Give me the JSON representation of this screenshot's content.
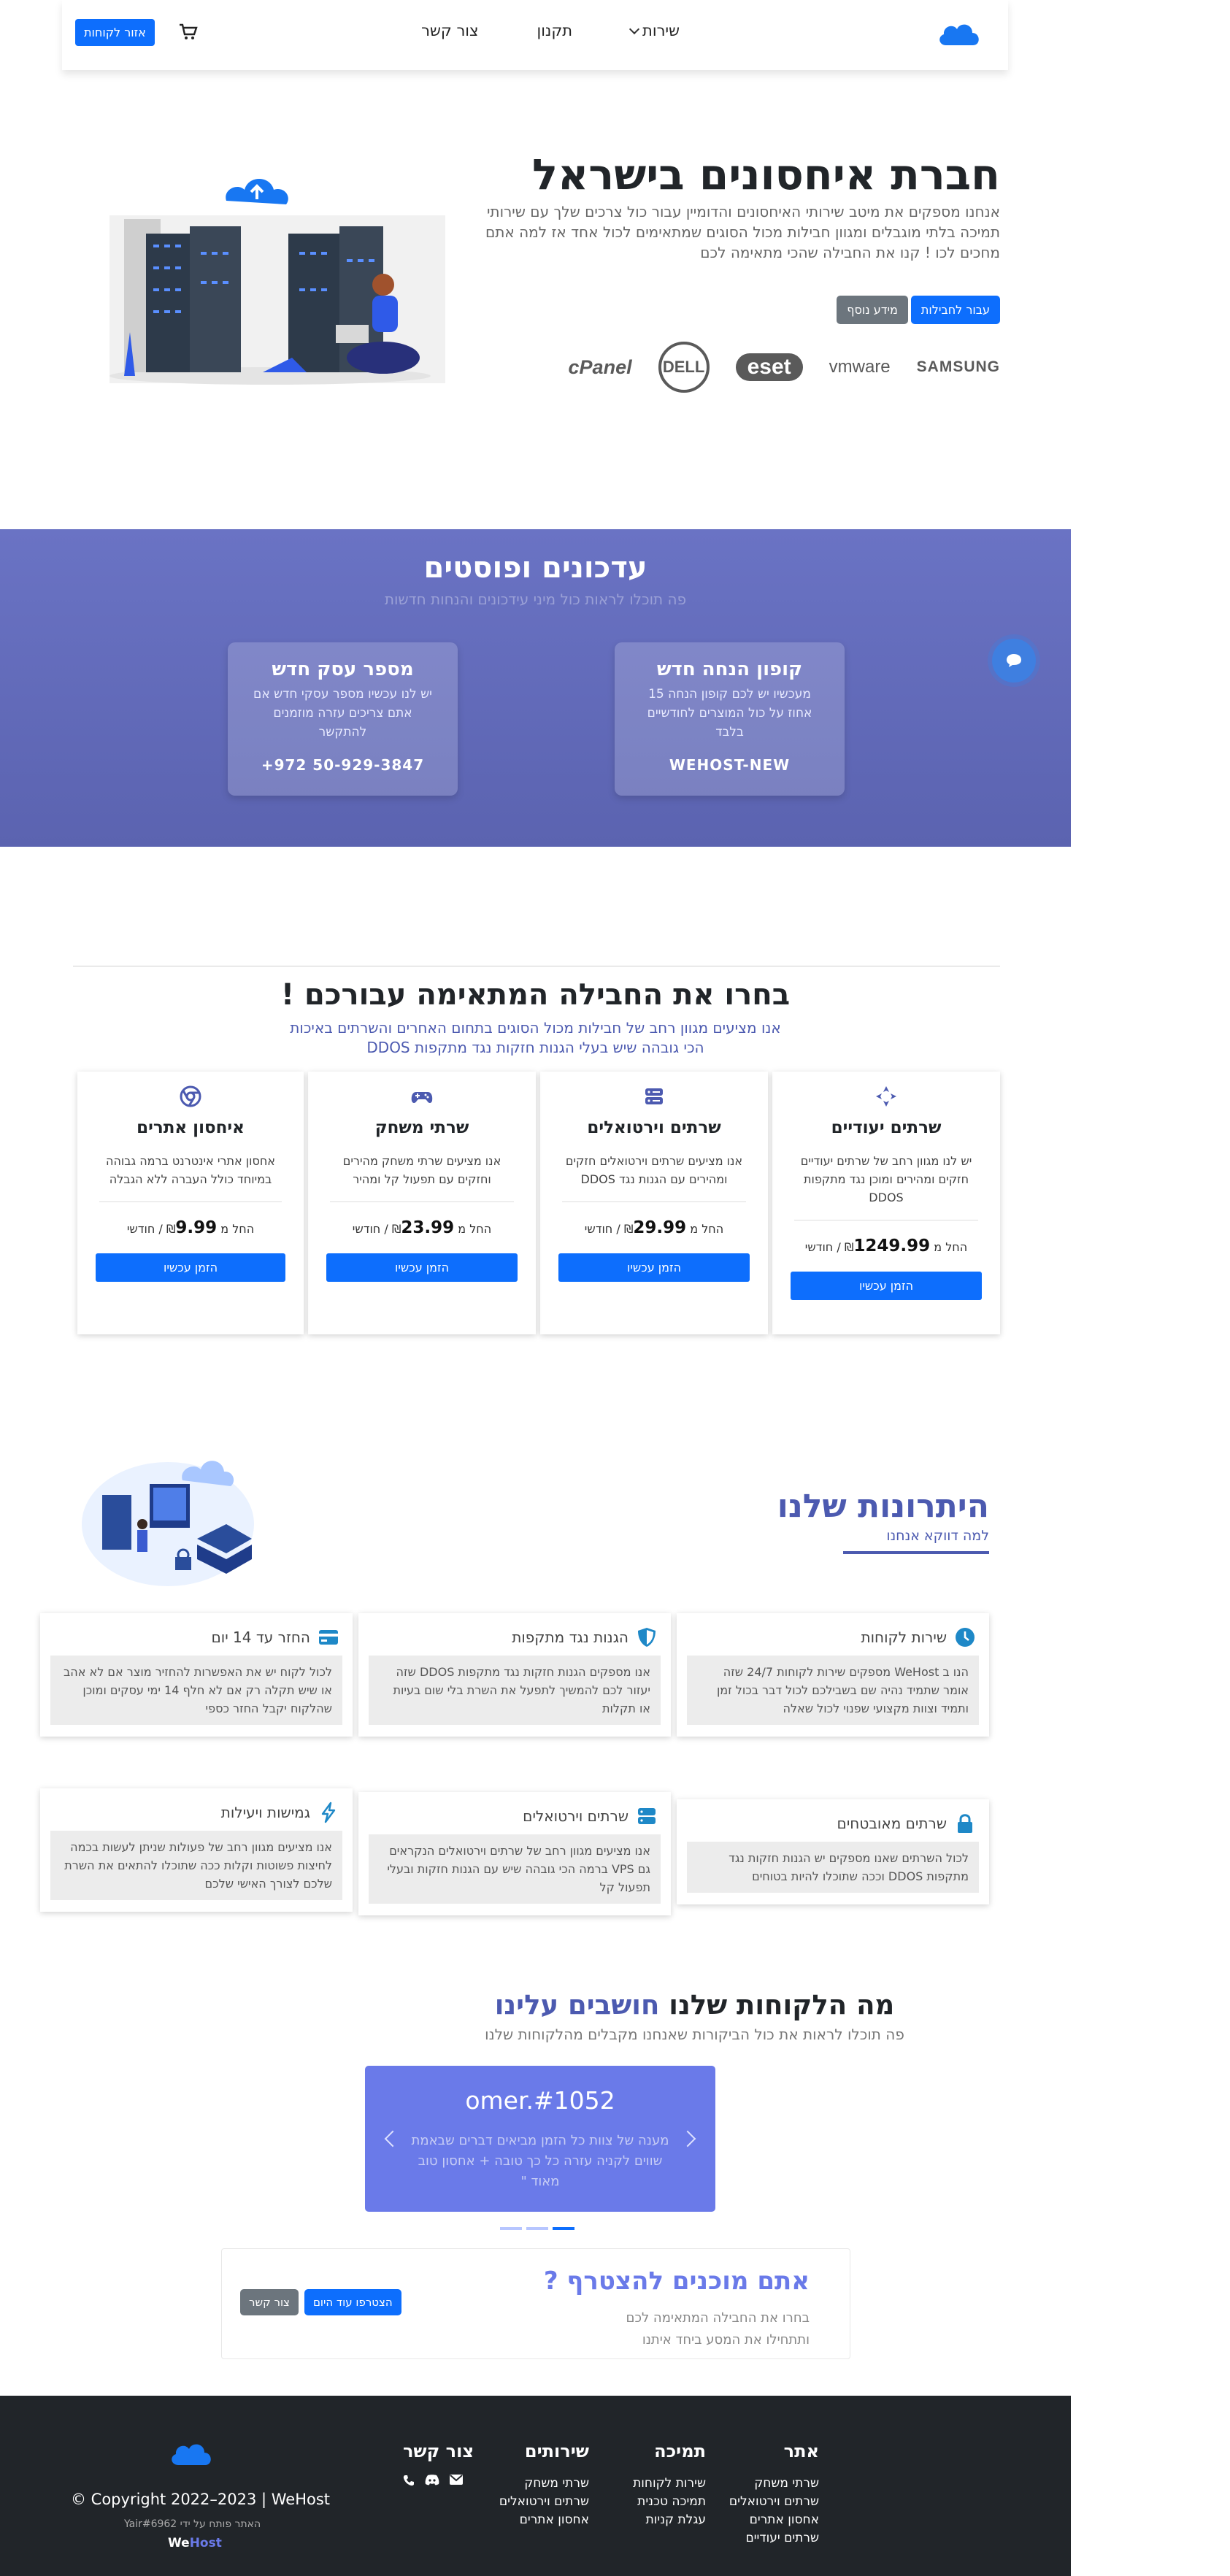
{
  "colors": {
    "primary": "#0d6efd",
    "accent": "#4c5ab0",
    "updates_bg": "#5b63b0",
    "footer_bg": "#212529"
  },
  "navbar": {
    "brand_icon": "cloud-logo-icon",
    "links": [
      "שירות",
      "תקנון",
      "צור קשר"
    ],
    "customers_button": "אזור לקוחות",
    "cart_icon": "cart-icon"
  },
  "hero": {
    "title": "חברת איחסונים בישראל",
    "description": "אנחנו מספקים את מיטב שירותי האיחסונים והדומיין עבור כול צרכים שלך עם שירותי תמיכה בלתי מוגבלים ומגוון חבילות מכול הסוגים שמתאימים לכול אחד אז למה אתם מחכים לכו ! קנו את החבילה שהכי מתאימה לכם",
    "button_packages": "עבור לחבילות",
    "button_more": "מידע נוסף",
    "brands": [
      "SAMSUNG",
      "vmware",
      "eset",
      "DELL",
      "cPanel"
    ]
  },
  "updates": {
    "title": "עדכונים ופוסטים",
    "subtitle": "פה תוכלו לראות כול מיני עידכונים והנחות חדשות",
    "cards": [
      {
        "title": "קופון הנחה חדש",
        "desc": "מעכשיו יש לכם קופון הנחה 15 אחוז על כול המוצרים לחודשיים בלבד",
        "value": "WEHOST-NEW"
      },
      {
        "title": "מספר עסק חדש",
        "desc": "יש לנו עכשיו מספר עסקי חדש אם אתם צריכים עזרה מוזמנים להתקשר",
        "value": "+972 50-929-3847"
      }
    ],
    "chat_icon": "chat-bubble-icon"
  },
  "packages": {
    "title": "בחרו את החבילה המתאימה עבורכם !",
    "subtitle_line1": "אנו מציעים מגוון רחב של חבילות מכול הסוגים בתחום האחרים והשרתים באיכות",
    "subtitle_line2": "הכי גובהה שיש בעלי הגנות חזקות נגד מתקפות DDOS",
    "price_prefix": "החל מ",
    "currency": "₪",
    "per_month": "/ חודשי",
    "order_label": "הזמן עכשיו",
    "items": [
      {
        "icon": "dedicated-server-icon",
        "name": "שרתים יעודיים",
        "desc": "יש לנו מגוון רחב של שרתים יעודיים חזקים ומהירים ומוכן נגד מתקפות DDOS",
        "price": "1249.99"
      },
      {
        "icon": "vps-server-icon",
        "name": "שרתים וירטואלים",
        "desc": "אנו מציעים שרתים וירטואלים חזקים ומהירים עם הגנות נגד DDOS",
        "price": "29.99"
      },
      {
        "icon": "gamepad-icon",
        "name": "שרתי משחק",
        "desc": "אנו מציעים שרתי משחק מהירים וחזקים עם תפעול קל ומהיר",
        "price": "23.99"
      },
      {
        "icon": "chrome-icon",
        "name": "איחסון אתרים",
        "desc": "אחסון אתרי אינטרנט ברמה גבוהה במיוחד כולל העברה ללא הגבלה",
        "price": "9.99"
      }
    ]
  },
  "advantages": {
    "title": "היתרונות שלנו",
    "subtitle": "למה דווקא אנחנו",
    "items": [
      {
        "icon": "clock-icon",
        "title": "שירות לקוחות",
        "desc": "הנו ב WeHost מספקים שירות לקוחות 24/7 שזה אומר שתמיד נהיה שם בשבילכם לכול דבר בכול זמן ותמיד וצוות מקצועי שפנוי לכול שאלה"
      },
      {
        "icon": "shield-icon",
        "title": "הגנות נגד מתקפות",
        "desc": "אנו מספקים הגנות חזקות נגד מתקפות DDOS שזה יעזור לכם להמשיך לתפעל את השרת בלי שום בעיות או תקלות"
      },
      {
        "icon": "credit-card-icon",
        "title": "החזר עד 14 יום",
        "desc": "לכול לקוח יש את האפשרות להחזיר מוצר אם לא אהב או שיש תקלה רק אם לא חלף 14 ימי עסקים ומוכן שהלקוח יקבל החזר כספי"
      },
      {
        "icon": "lock-icon",
        "title": "שרתים מאובטחים",
        "desc": "לכול השרתים שאנו מספקים יש הגנות חזקות נגד מתקפות DDOS וככה שתוכלו להיות בטוחים"
      },
      {
        "icon": "server-icon",
        "title": "שרתים וירטואלים",
        "desc": "אנו מציעים מגוון רחב של שרתים וירטואלים הנקראים גם VPS ברמה הכי גובהה שיש עם הגנות חזקות ובעלי תפעול קל"
      },
      {
        "icon": "lightning-icon",
        "title": "גמישות ויעילות",
        "desc": "אנו מציעים מגוון רחב של פעולות שניתן לעשות בכמה לחיצות פשוטות וקלות ככה שתוכלו להתאים את השרת שלכם לצורך האישי שלכם"
      }
    ]
  },
  "testimonials": {
    "title_prefix": "מה הלקוחות שלנו",
    "title_highlight": "חושבים עלינו",
    "subtitle": "פה תוכלו לראות את כול הביקורות שאנחנו מקבלים מהלקוחות שלנו",
    "name": "omer.#1052",
    "quote": "מענה של צוות כל הזמן מביאים דברים שבאמת שווים לקניה עזרה כל כך טובה + אחסון טוב מאוד \""
  },
  "join": {
    "title": "אתם מוכנים להצטרף ?",
    "desc_line1": "בחרו את החבילה המתאימה לכם",
    "desc_line2": "ותתחילו את המסע ביחד איתנו",
    "button_join": "הצטרפו עוד היום",
    "button_contact": "צור קשר"
  },
  "footer": {
    "cols": [
      {
        "title": "אתר",
        "links": [
          "שרתי משחק",
          "שרתים וירטואלים",
          "אחסון אתרים",
          "שרתים יעודיים"
        ]
      },
      {
        "title": "תמיכה",
        "links": [
          "שירות לקוחות",
          "תמיכה טכנית",
          "עגלת קניות"
        ]
      },
      {
        "title": "שירותים",
        "links": [
          "שרתי משחק",
          "שרתים וירטואלים",
          "אחסון אתרים"
        ]
      },
      {
        "title": "צור קשר",
        "links": []
      }
    ],
    "contact_icons": [
      "mail-icon",
      "discord-icon",
      "phone-icon"
    ],
    "copyright": "© Copyright 2022–2023 | WeHost",
    "made_by": "האתר פותח על ידי Yair#6962",
    "brand_part1": "We",
    "brand_part2": "Host"
  }
}
